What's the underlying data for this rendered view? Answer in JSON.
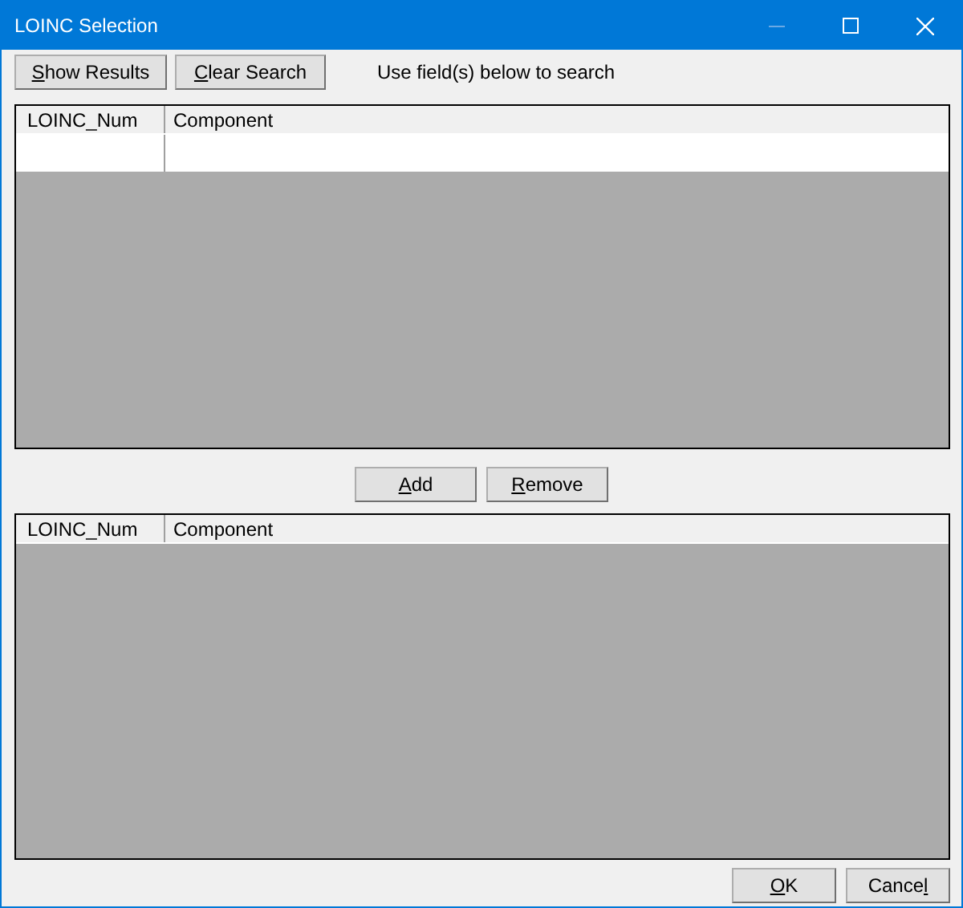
{
  "window": {
    "title": "LOINC Selection"
  },
  "toolbar": {
    "buttons": [
      {
        "key": "S",
        "after": "how Results"
      },
      {
        "key": "C",
        "after": "lear Search"
      }
    ],
    "hint": "Use field(s) below to search"
  },
  "search_grid": {
    "columns": [
      "LOINC_Num",
      "Component"
    ],
    "blank_row": true
  },
  "middle_buttons": [
    {
      "key": "A",
      "after": "dd"
    },
    {
      "key": "R",
      "after": "emove"
    }
  ],
  "selected_grid": {
    "columns": [
      "LOINC_Num",
      "Component"
    ]
  },
  "dialog_buttons": [
    {
      "key": "O",
      "after": "K"
    },
    {
      "before": "Cance",
      "key": "l"
    }
  ]
}
